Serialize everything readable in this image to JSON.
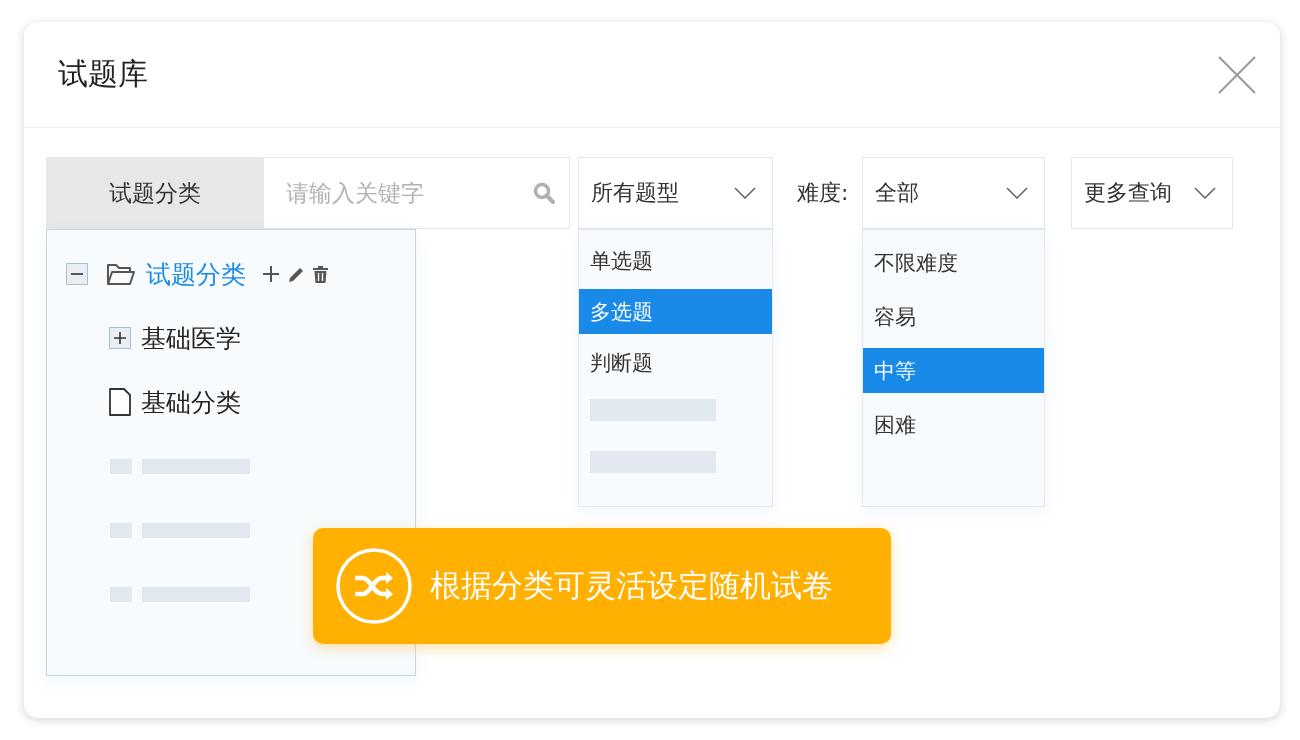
{
  "window": {
    "title": "试题库"
  },
  "category": {
    "label": "试题分类",
    "expanded": true,
    "tree": [
      {
        "kind": "folder",
        "label": "试题分类",
        "expanded": true,
        "selected": true,
        "children": [
          {
            "kind": "folder",
            "label": "基础医学",
            "expanded": false,
            "selected": false
          },
          {
            "kind": "file",
            "label": "基础分类",
            "selected": false
          }
        ]
      },
      {
        "kind": "placeholder"
      },
      {
        "kind": "placeholder"
      },
      {
        "kind": "placeholder"
      }
    ]
  },
  "search": {
    "placeholder": "请输入关键字"
  },
  "type_filter": {
    "value": "所有题型",
    "expanded": true,
    "options": [
      {
        "kind": "option",
        "label": "单选题",
        "selected": false
      },
      {
        "kind": "option",
        "label": "多选题",
        "selected": true
      },
      {
        "kind": "option",
        "label": "判断题",
        "selected": false
      },
      {
        "kind": "placeholder"
      },
      {
        "kind": "placeholder"
      }
    ]
  },
  "difficulty_filter": {
    "label": "难度:",
    "value": "全部",
    "expanded": true,
    "options": [
      {
        "kind": "option",
        "label": "不限难度",
        "selected": false
      },
      {
        "kind": "option",
        "label": "容易",
        "selected": false
      },
      {
        "kind": "option",
        "label": "中等",
        "selected": true
      },
      {
        "kind": "option",
        "label": "困难",
        "selected": false
      }
    ]
  },
  "more_filter": {
    "value": "更多查询",
    "expanded": false
  },
  "banner": {
    "text": "根据分类可灵活设定随机试卷"
  }
}
